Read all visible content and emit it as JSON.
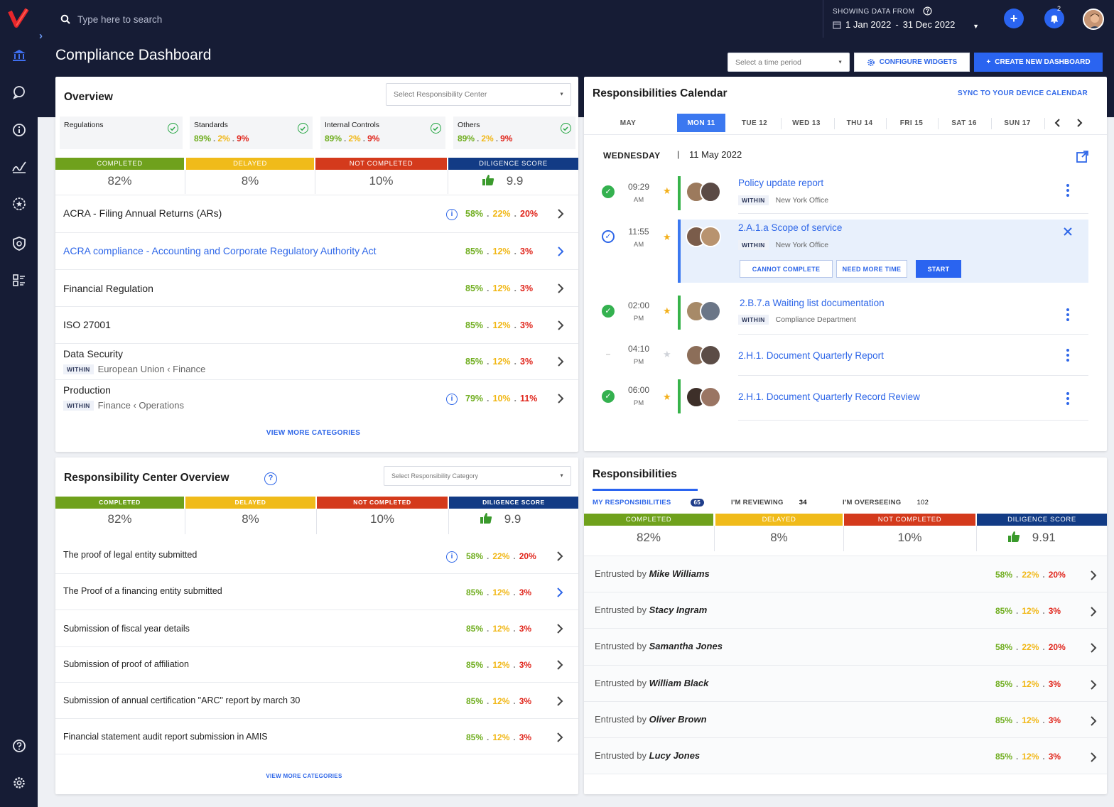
{
  "header": {
    "search_placeholder": "Type here to search",
    "date_label": "SHOWING DATA FROM",
    "date_start": "1 Jan 2022",
    "date_sep": "-",
    "date_end": "31 Dec 2022",
    "notification_count": "2"
  },
  "sidebar": {
    "icons": [
      "bank-icon",
      "chat-icon",
      "info-icon",
      "signature-icon",
      "badge-icon",
      "shield-icon",
      "list-icon"
    ],
    "bottom_icons": [
      "help-icon",
      "gear-icon"
    ]
  },
  "page": {
    "title": "Compliance Dashboard",
    "time_period_placeholder": "Select a time period",
    "configure_label": "CONFIGURE WIDGETS",
    "create_label": "CREATE NEW DASHBOARD"
  },
  "colors": {
    "completed": "#6fa11c",
    "delayed": "#f0bb1a",
    "not_completed": "#d43a1c",
    "diligence": "#123b85",
    "accent": "#2a64f0",
    "dark": "#161c35"
  },
  "overview": {
    "title": "Overview",
    "select_placeholder": "Select Responsibility Center",
    "minis": [
      {
        "label": "Regulations",
        "completed": "",
        "delayed": "",
        "not_completed": ""
      },
      {
        "label": "Standards",
        "completed": "89%",
        "delayed": "2%",
        "not_completed": "9%"
      },
      {
        "label": "Internal Controls",
        "completed": "89%",
        "delayed": "2%",
        "not_completed": "9%"
      },
      {
        "label": "Others",
        "completed": "89%",
        "delayed": "2%",
        "not_completed": "9%"
      }
    ],
    "stats": {
      "completed_label": "COMPLETED",
      "delayed_label": "DELAYED",
      "not_completed_label": "NOT COMPLETED",
      "diligence_label": "DILIGENCE SCORE",
      "completed": "82%",
      "delayed": "8%",
      "not_completed": "10%",
      "diligence": "9.9"
    },
    "rows": [
      {
        "title": "ACRA - Filing Annual Returns (ARs)",
        "within": "",
        "path": "",
        "c": "58%",
        "d": "22%",
        "n": "20%"
      },
      {
        "title": "ACRA compliance - Accounting and Corporate Regulatory Authority Act",
        "within": "",
        "path": "",
        "c": "85%",
        "d": "12%",
        "n": "3%"
      },
      {
        "title": "Financial Regulation",
        "within": "",
        "path": "",
        "c": "85%",
        "d": "12%",
        "n": "3%"
      },
      {
        "title": "ISO 27001",
        "within": "",
        "path": "",
        "c": "85%",
        "d": "12%",
        "n": "3%"
      },
      {
        "title": "Data Security",
        "within": "WITHIN",
        "path": "European Union ‹ Finance",
        "c": "85%",
        "d": "12%",
        "n": "3%"
      },
      {
        "title": "Production",
        "within": "WITHIN",
        "path": "Finance ‹ Operations",
        "c": "79%",
        "d": "10%",
        "n": "11%"
      }
    ],
    "view_more": "VIEW MORE CATEGORIES"
  },
  "rc_overview": {
    "title": "Responsibility Center Overview",
    "select_placeholder": "Select Responsibility Category",
    "stats": {
      "completed_label": "COMPLETED",
      "delayed_label": "DELAYED",
      "not_completed_label": "NOT COMPLETED",
      "diligence_label": "DILIGENCE SCORE",
      "completed": "82%",
      "delayed": "8%",
      "not_completed": "10%",
      "diligence": "9.9"
    },
    "rows": [
      {
        "title": "The proof of legal entity submitted",
        "c": "58%",
        "d": "22%",
        "n": "20%"
      },
      {
        "title": "The Proof of a financing entity submitted",
        "c": "85%",
        "d": "12%",
        "n": "3%"
      },
      {
        "title": "Submission of fiscal year details",
        "c": "85%",
        "d": "12%",
        "n": "3%"
      },
      {
        "title": "Submission of proof of affiliation",
        "c": "85%",
        "d": "12%",
        "n": "3%"
      },
      {
        "title": "Submission of annual certification \"ARC\" report by march 30",
        "c": "85%",
        "d": "12%",
        "n": "3%"
      },
      {
        "title": "Financial statement audit report submission in AMIS",
        "c": "85%",
        "d": "12%",
        "n": "3%"
      }
    ],
    "view_more": "VIEW MORE CATEGORIES"
  },
  "calendar": {
    "title": "Responsibilities Calendar",
    "sync_label": "SYNC TO YOUR DEVICE CALENDAR",
    "month": "MAY",
    "days": [
      "MON 11",
      "TUE 12",
      "WED 13",
      "THU 14",
      "FRI 15",
      "SAT 16",
      "SUN 17"
    ],
    "day_name": "WEDNESDAY",
    "day_sep": "|",
    "full_date": "11 May 2022",
    "events": [
      {
        "time": "09:29",
        "ampm": "AM",
        "title": "Policy update report",
        "within": "WITHIN",
        "location": "New York Office"
      },
      {
        "time": "11:55",
        "ampm": "AM",
        "title": "2.A.1.a Scope of service",
        "within": "WITHIN",
        "location": "New York Office"
      },
      {
        "time": "02:00",
        "ampm": "PM",
        "title": "2.B.7.a Waiting list documentation",
        "within": "WITHIN",
        "location": "Compliance Department"
      },
      {
        "time": "04:10",
        "ampm": "PM",
        "title": "2.H.1. Document Quarterly Report",
        "within": "",
        "location": ""
      },
      {
        "time": "06:00",
        "ampm": "PM",
        "title": "2.H.1. Document Quarterly Record Review",
        "within": "",
        "location": ""
      }
    ],
    "actions": {
      "cannot": "CANNOT COMPLETE",
      "more_time": "NEED MORE TIME",
      "start": "START"
    }
  },
  "responsibilities": {
    "title": "Responsibilities",
    "tabs": [
      {
        "label": "MY RESPONSIBILITIES",
        "count": "65"
      },
      {
        "label": "I'M REVIEWING",
        "count": "34"
      },
      {
        "label": "I'M OVERSEEING",
        "count": "102"
      }
    ],
    "stats": {
      "completed_label": "COMPLETED",
      "delayed_label": "DELAYED",
      "not_completed_label": "NOT COMPLETED",
      "diligence_label": "DILIGENCE SCORE",
      "completed": "82%",
      "delayed": "8%",
      "not_completed": "10%",
      "diligence": "9.91"
    },
    "prefix": "Entrusted by",
    "rows": [
      {
        "name": "Mike Williams",
        "c": "58%",
        "d": "22%",
        "n": "20%"
      },
      {
        "name": "Stacy Ingram",
        "c": "85%",
        "d": "12%",
        "n": "3%"
      },
      {
        "name": "Samantha Jones",
        "c": "58%",
        "d": "22%",
        "n": "20%"
      },
      {
        "name": "William Black",
        "c": "85%",
        "d": "12%",
        "n": "3%"
      },
      {
        "name": "Oliver Brown",
        "c": "85%",
        "d": "12%",
        "n": "3%"
      },
      {
        "name": "Lucy Jones",
        "c": "85%",
        "d": "12%",
        "n": "3%"
      }
    ]
  }
}
